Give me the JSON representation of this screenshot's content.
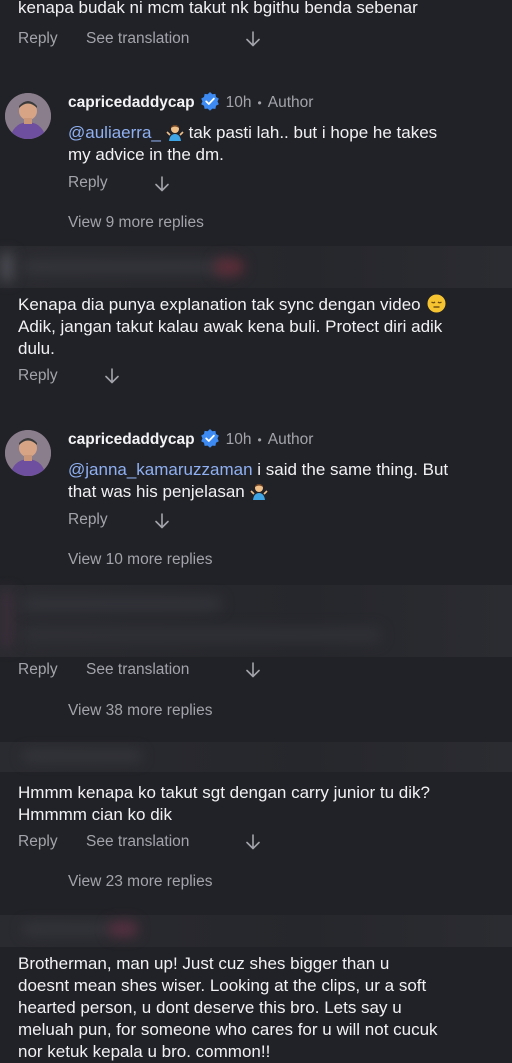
{
  "comments": [
    {
      "text": "kenapa budak ni mcm takut nk bgithu benda sebenar",
      "reply_label": "Reply",
      "translate_label": "See translation"
    },
    {
      "username": "capricedaddycap",
      "time": "10h",
      "separator": "•",
      "author_label": "Author",
      "mention": "@auliaerra_",
      "text_after_emoji": " tak pasti lah.. but i hope he takes",
      "text_line2": "my advice in the dm.",
      "reply_label": "Reply",
      "view_more": "View 9 more replies"
    },
    {
      "text_line1": "Kenapa dia punya explanation tak sync dengan video",
      "text_line2": "Adik, jangan takut kalau awak kena buli. Protect diri adik",
      "text_line3": "dulu.",
      "reply_label": "Reply"
    },
    {
      "username": "capricedaddycap",
      "time": "10h",
      "separator": "•",
      "author_label": "Author",
      "mention": "@janna_kamaruzzaman",
      "text_after_mention": " i said the same thing. But",
      "text_line2": "that was his penjelasan",
      "reply_label": "Reply",
      "view_more": "View 10 more replies"
    },
    {
      "reply_label": "Reply",
      "translate_label": "See translation",
      "view_more": "View 38 more replies"
    },
    {
      "text_line1": "Hmmm kenapa ko takut sgt dengan carry junior tu dik?",
      "text_line2": "Hmmmm cian ko dik",
      "reply_label": "Reply",
      "translate_label": "See translation",
      "view_more": "View 23 more replies"
    },
    {
      "text_line1": "Brotherman, man up! Just cuz shes bigger than u",
      "text_line2": "doesnt mean shes wiser. Looking at the clips, ur a soft",
      "text_line3": "hearted person, u dont deserve this bro. Lets say u",
      "text_line4": "meluah pun, for someone who cares for u will not cucuk",
      "text_line5": "nor ketuk kepala u bro. common!!"
    }
  ],
  "colors": {
    "background": "#212227",
    "secondary_text": "#a3a4ab",
    "mention": "#8fb0f2",
    "verified": "#3d8bf2"
  },
  "icons": [
    "arrow-down-icon",
    "verified-badge-icon",
    "avatar",
    "person-shrugging-emoji",
    "expressionless-face-emoji"
  ]
}
